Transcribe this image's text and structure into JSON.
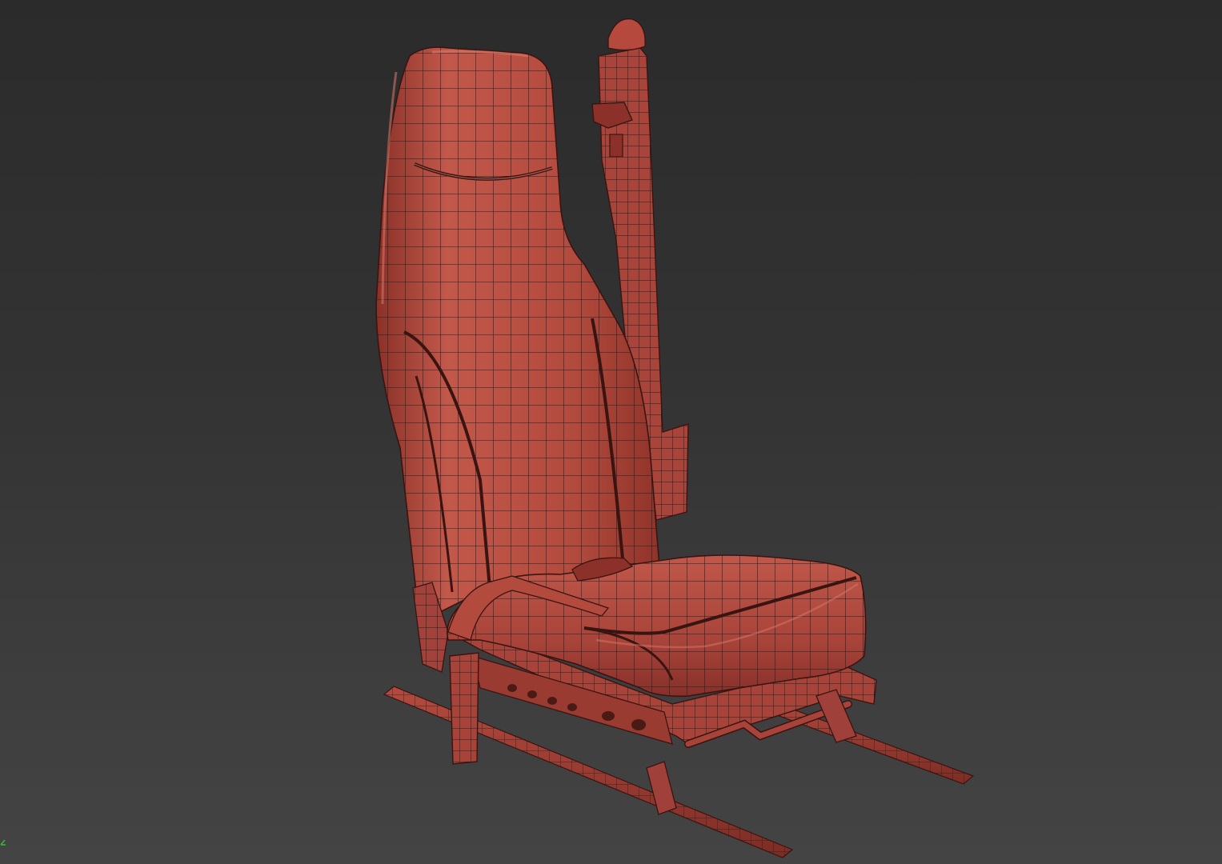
{
  "viewport": {
    "background_top": "#2b2b2b",
    "background_bottom": "#444444"
  },
  "model": {
    "object": "car-seat",
    "display_mode": "shaded-wireframe",
    "surface_color": "#b84a3e",
    "wire_color": "#3a1410",
    "highlight_color": "#d8786a",
    "shadow_color": "#7a2a22"
  },
  "gizmo": {
    "icon": "axis-tripod-icon",
    "color": "#2fbf2f"
  }
}
